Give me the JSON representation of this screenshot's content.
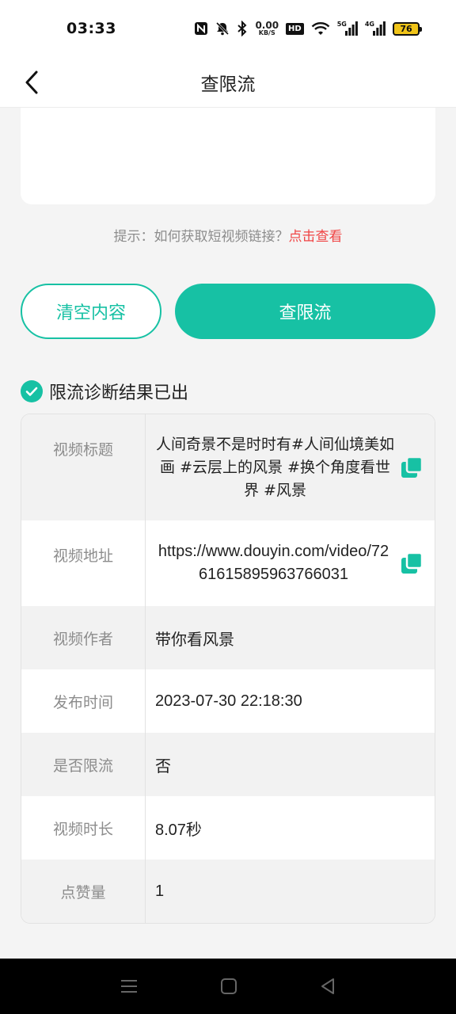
{
  "status_bar": {
    "time": "03:33",
    "net_speed_value": "0.00",
    "net_speed_unit": "KB/S",
    "hd_label": "HD",
    "sig1_label": "5G",
    "sig2_label": "4G",
    "battery": "76"
  },
  "nav": {
    "title": "查限流"
  },
  "hint": {
    "text": "提示：如何获取短视频链接？",
    "link": "点击查看"
  },
  "buttons": {
    "clear": "清空内容",
    "query": "查限流"
  },
  "result": {
    "title": "限流诊断结果已出",
    "rows": [
      {
        "label": "视频标题",
        "value": "人间奇景不是时时有#人间仙境美如画 #云层上的风景 #换个角度看世界 #风景"
      },
      {
        "label": "视频地址",
        "value": "https://www.douyin.com/video/7261615895963766031"
      },
      {
        "label": "视频作者",
        "value": "带你看风景"
      },
      {
        "label": "发布时间",
        "value": "2023-07-30 22:18:30"
      },
      {
        "label": "是否限流",
        "value": "否"
      },
      {
        "label": "视频时长",
        "value": "8.07秒"
      },
      {
        "label": "点赞量",
        "value": "1"
      }
    ]
  },
  "colors": {
    "accent": "#17c1a4",
    "link": "#f04545"
  }
}
